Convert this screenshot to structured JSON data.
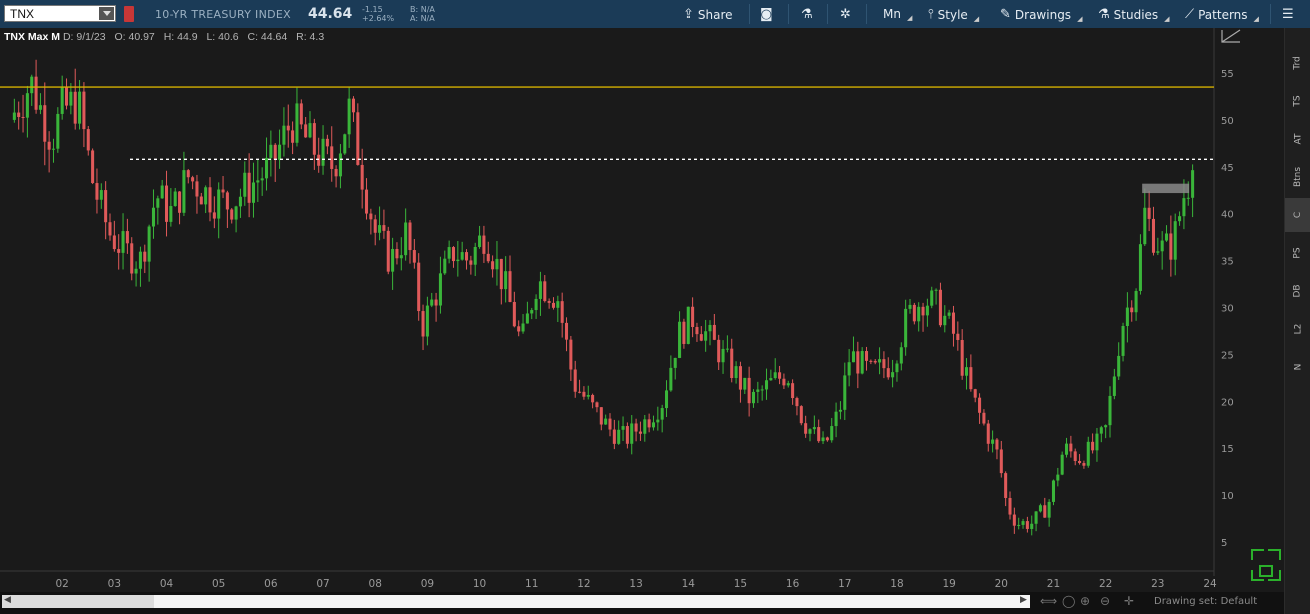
{
  "toolbar": {
    "symbol": "TNX",
    "description": "10-YR TREASURY INDEX",
    "last_price": "44.64",
    "net_change": "-1.15",
    "pct_change": "+2.64%",
    "bid": "B: N/A",
    "ask": "A: N/A",
    "share_label": "Share",
    "mn_label": "Mn",
    "style_label": "Style",
    "drawings_label": "Drawings",
    "studies_label": "Studies",
    "patterns_label": "Patterns"
  },
  "info_line": {
    "title": "TNX Max M",
    "date": "D: 9/1/23",
    "open": "O: 40.97",
    "high": "H: 44.9",
    "low": "L: 40.6",
    "close": "C: 44.64",
    "range": "R: 4.3"
  },
  "right_tabs": [
    "Trd",
    "TS",
    "AT",
    "Btns",
    "C",
    "PS",
    "DB",
    "L2",
    "N"
  ],
  "right_tabs_active": "C",
  "bottom": {
    "drawing_set": "Drawing set: Default"
  },
  "colors": {
    "up": "#3ab53a",
    "down": "#e05a5a",
    "resistance": "#d4b000",
    "toolbar_bg": "#1b3b57",
    "background": "#1a1a1a"
  },
  "chart_data": {
    "type": "candlestick",
    "symbol": "TNX",
    "aggregation": "Max M",
    "x_tick_labels": [
      "02",
      "03",
      "04",
      "05",
      "06",
      "07",
      "08",
      "09",
      "10",
      "11",
      "12",
      "13",
      "14",
      "15",
      "16",
      "17",
      "18",
      "19",
      "20",
      "21",
      "22",
      "23",
      "24"
    ],
    "y_tick_labels": [
      5,
      10,
      15,
      20,
      25,
      30,
      35,
      40,
      45,
      50,
      55
    ],
    "ylim": [
      2.0,
      58.0
    ],
    "x_start_year": 2001.0,
    "x_end_year": 2024.0,
    "horizontal_lines": [
      {
        "kind": "solid",
        "value": 53.5,
        "color": "#d4b000"
      },
      {
        "kind": "dotted",
        "value": 45.8,
        "color": "#ffffff",
        "from_year": 2003.3
      }
    ],
    "highlight_bar": {
      "value_low": 42.2,
      "value_high": 43.2,
      "from_year": 2022.7,
      "to_year": 2023.6
    },
    "anchor_closes": [
      [
        2001.0,
        50.0
      ],
      [
        2001.4,
        54.0
      ],
      [
        2001.8,
        48.0
      ],
      [
        2002.0,
        51.0
      ],
      [
        2002.3,
        52.0
      ],
      [
        2002.6,
        43.0
      ],
      [
        2002.9,
        38.0
      ],
      [
        2003.2,
        36.0
      ],
      [
        2003.5,
        35.0
      ],
      [
        2003.8,
        42.0
      ],
      [
        2004.1,
        40.0
      ],
      [
        2004.4,
        44.0
      ],
      [
        2004.8,
        42.0
      ],
      [
        2005.2,
        41.0
      ],
      [
        2005.6,
        43.0
      ],
      [
        2006.0,
        45.0
      ],
      [
        2006.4,
        50.0
      ],
      [
        2006.8,
        47.0
      ],
      [
        2007.2,
        45.0
      ],
      [
        2007.5,
        51.0
      ],
      [
        2007.8,
        43.0
      ],
      [
        2008.0,
        38.0
      ],
      [
        2008.3,
        35.0
      ],
      [
        2008.6,
        38.0
      ],
      [
        2008.9,
        28.0
      ],
      [
        2009.2,
        32.0
      ],
      [
        2009.5,
        36.0
      ],
      [
        2009.8,
        35.0
      ],
      [
        2010.1,
        38.0
      ],
      [
        2010.5,
        32.0
      ],
      [
        2010.8,
        26.0
      ],
      [
        2011.1,
        33.0
      ],
      [
        2011.5,
        31.0
      ],
      [
        2011.8,
        22.0
      ],
      [
        2012.2,
        19.0
      ],
      [
        2012.5,
        17.0
      ],
      [
        2012.8,
        16.0
      ],
      [
        2013.2,
        18.0
      ],
      [
        2013.5,
        20.0
      ],
      [
        2013.8,
        27.0
      ],
      [
        2014.1,
        29.0
      ],
      [
        2014.5,
        26.0
      ],
      [
        2014.9,
        23.0
      ],
      [
        2015.2,
        20.0
      ],
      [
        2015.6,
        22.0
      ],
      [
        2015.9,
        23.0
      ],
      [
        2016.2,
        18.0
      ],
      [
        2016.6,
        15.0
      ],
      [
        2016.9,
        19.0
      ],
      [
        2017.1,
        25.0
      ],
      [
        2017.5,
        23.0
      ],
      [
        2017.9,
        24.0
      ],
      [
        2018.2,
        29.0
      ],
      [
        2018.5,
        31.0
      ],
      [
        2018.8,
        30.0
      ],
      [
        2019.1,
        27.0
      ],
      [
        2019.4,
        21.0
      ],
      [
        2019.7,
        17.0
      ],
      [
        2019.95,
        14.0
      ],
      [
        2020.1,
        9.0
      ],
      [
        2020.3,
        7.0
      ],
      [
        2020.6,
        7.0
      ],
      [
        2020.9,
        9.0
      ],
      [
        2021.2,
        15.0
      ],
      [
        2021.5,
        14.0
      ],
      [
        2021.8,
        15.0
      ],
      [
        2022.0,
        17.0
      ],
      [
        2022.3,
        28.0
      ],
      [
        2022.6,
        33.0
      ],
      [
        2022.75,
        40.0
      ],
      [
        2022.9,
        38.0
      ],
      [
        2023.1,
        36.0
      ],
      [
        2023.3,
        37.0
      ],
      [
        2023.5,
        42.0
      ],
      [
        2023.66,
        44.64
      ]
    ]
  }
}
